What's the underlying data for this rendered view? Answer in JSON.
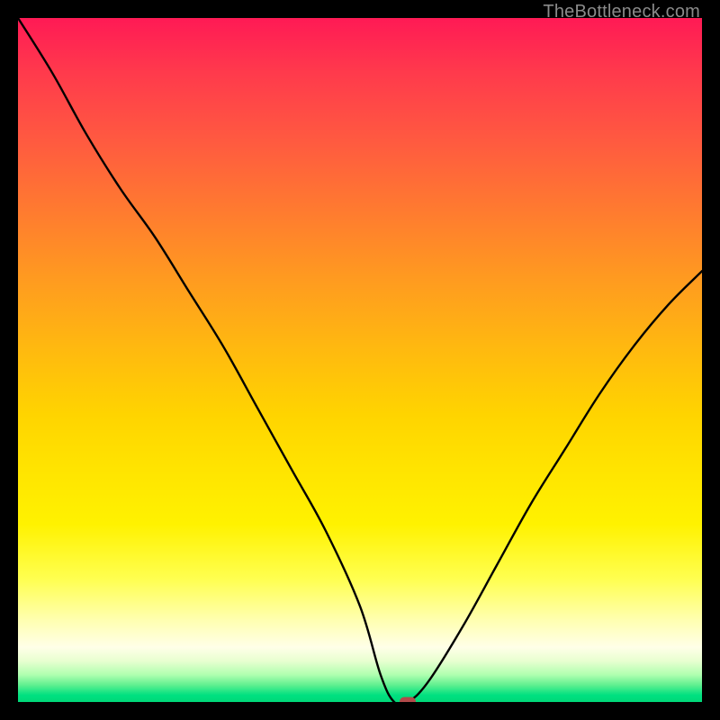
{
  "watermark": "TheBottleneck.com",
  "chart_data": {
    "type": "line",
    "title": "",
    "xlabel": "",
    "ylabel": "",
    "xlim": [
      0,
      100
    ],
    "ylim": [
      0,
      100
    ],
    "x": [
      0,
      5,
      10,
      15,
      20,
      25,
      30,
      35,
      40,
      45,
      50,
      53,
      55,
      57,
      60,
      65,
      70,
      75,
      80,
      85,
      90,
      95,
      100
    ],
    "values": [
      100,
      92,
      83,
      75,
      68,
      60,
      52,
      43,
      34,
      25,
      14,
      4,
      0,
      0,
      3,
      11,
      20,
      29,
      37,
      45,
      52,
      58,
      63
    ],
    "minimum_x": 56,
    "marker": {
      "x": 57,
      "y": 0,
      "color": "#b24a4a"
    },
    "gradient_stops": [
      {
        "pct": 0,
        "color": "#ff1a55"
      },
      {
        "pct": 50,
        "color": "#ffd400"
      },
      {
        "pct": 90,
        "color": "#ffffc0"
      },
      {
        "pct": 100,
        "color": "#00d878"
      }
    ]
  }
}
